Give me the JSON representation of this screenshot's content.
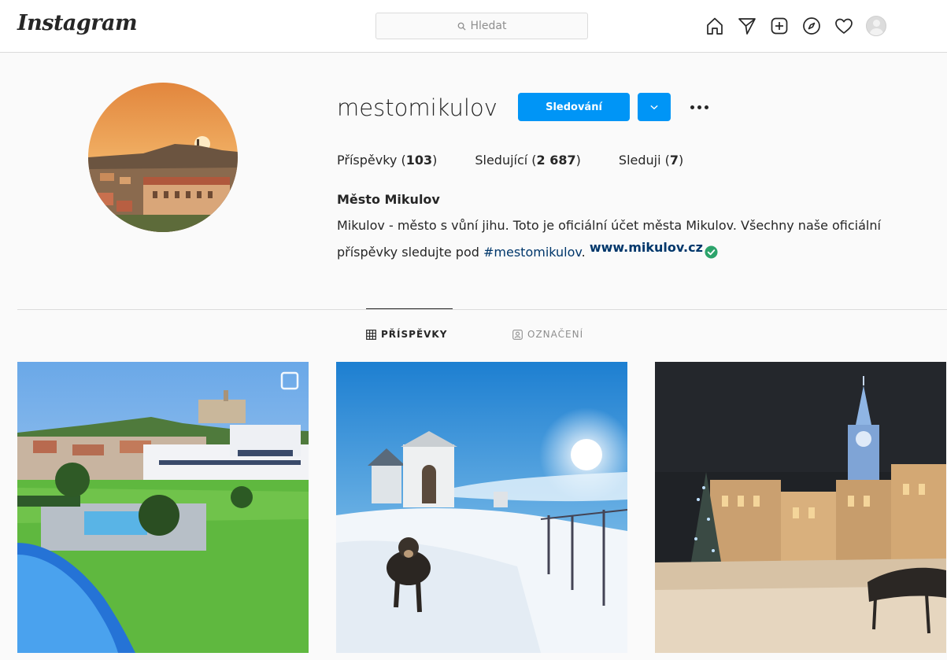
{
  "header": {
    "logo": "Instagram",
    "search_placeholder": "Hledat",
    "nav_icons": [
      "home-icon",
      "direct-icon",
      "new-post-icon",
      "explore-icon",
      "activity-heart-icon",
      "profile-avatar"
    ]
  },
  "profile": {
    "username": "mestomikulov",
    "follow_button": "Sledování",
    "stats": [
      {
        "label": "Příspěvky",
        "value": "103"
      },
      {
        "label": "Sledující",
        "value": "2 687"
      },
      {
        "label": "Sleduji",
        "value": "7"
      }
    ],
    "full_name": "Město Mikulov",
    "bio_text": "Mikulov - město s vůní jihu. Toto je oficiální účet města Mikulov. Všechny naše oficiální příspěvky sledujte pod",
    "bio_hashtag": "#mestomikulov",
    "bio_link": "www.mikulov.cz"
  },
  "tabs": [
    {
      "label": "PŘÍSPĚVKY",
      "active": true
    },
    {
      "label": "OZNAČENÍ",
      "active": false
    }
  ],
  "colors": {
    "accent": "#0095f6",
    "link": "#00376b",
    "verified": "#2ca36b"
  }
}
